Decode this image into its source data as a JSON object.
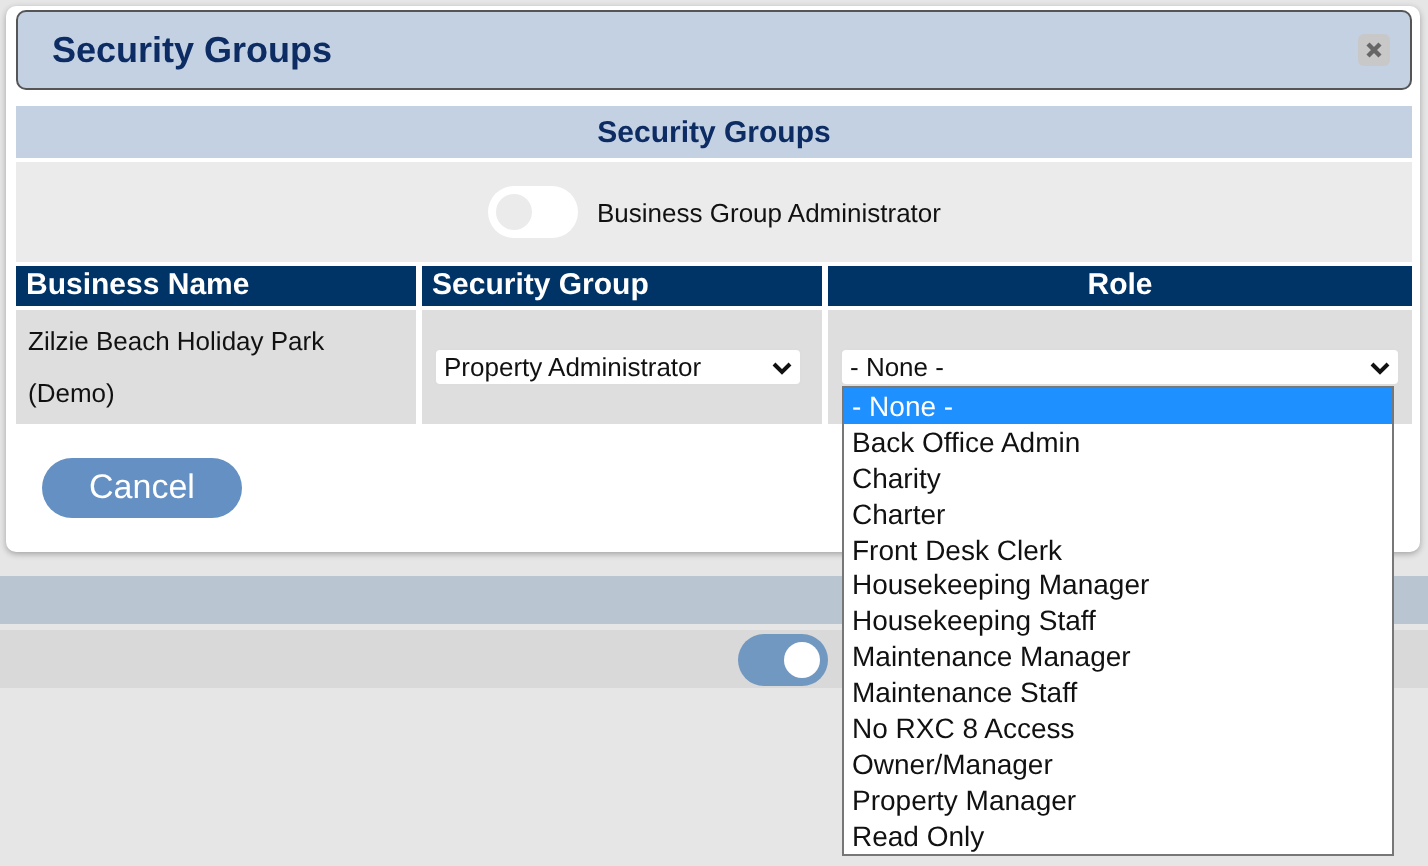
{
  "dialog": {
    "title": "Security Groups",
    "section_title": "Security Groups",
    "admin_toggle": {
      "label": "Business Group Administrator",
      "on": false
    },
    "table": {
      "columns": [
        "Business Name",
        "Security Group",
        "Role"
      ],
      "rows": [
        {
          "business_name": "Zilzie Beach Holiday Park (Demo)",
          "security_group": "Property Administrator",
          "role": "- None -"
        }
      ]
    },
    "cancel": "Cancel"
  },
  "role_dropdown": {
    "options": [
      {
        "label": "- None -",
        "selected": true
      },
      {
        "label": "Back Office Admin",
        "selected": false
      },
      {
        "label": "Charity",
        "selected": false
      },
      {
        "label": "Charter",
        "selected": false
      },
      {
        "label": "Front Desk Clerk",
        "selected": false
      },
      {
        "label": "Housekeeping Manager",
        "selected": false
      },
      {
        "label": "Housekeeping Staff",
        "selected": false
      },
      {
        "label": "Maintenance Manager",
        "selected": false
      },
      {
        "label": "Maintenance Staff",
        "selected": false
      },
      {
        "label": "No RXC 8 Access",
        "selected": false
      },
      {
        "label": "Owner/Manager",
        "selected": false
      },
      {
        "label": "Property Manager",
        "selected": false
      },
      {
        "label": "Read Only",
        "selected": false
      }
    ]
  },
  "background": {
    "toggle": {
      "on": true
    }
  }
}
